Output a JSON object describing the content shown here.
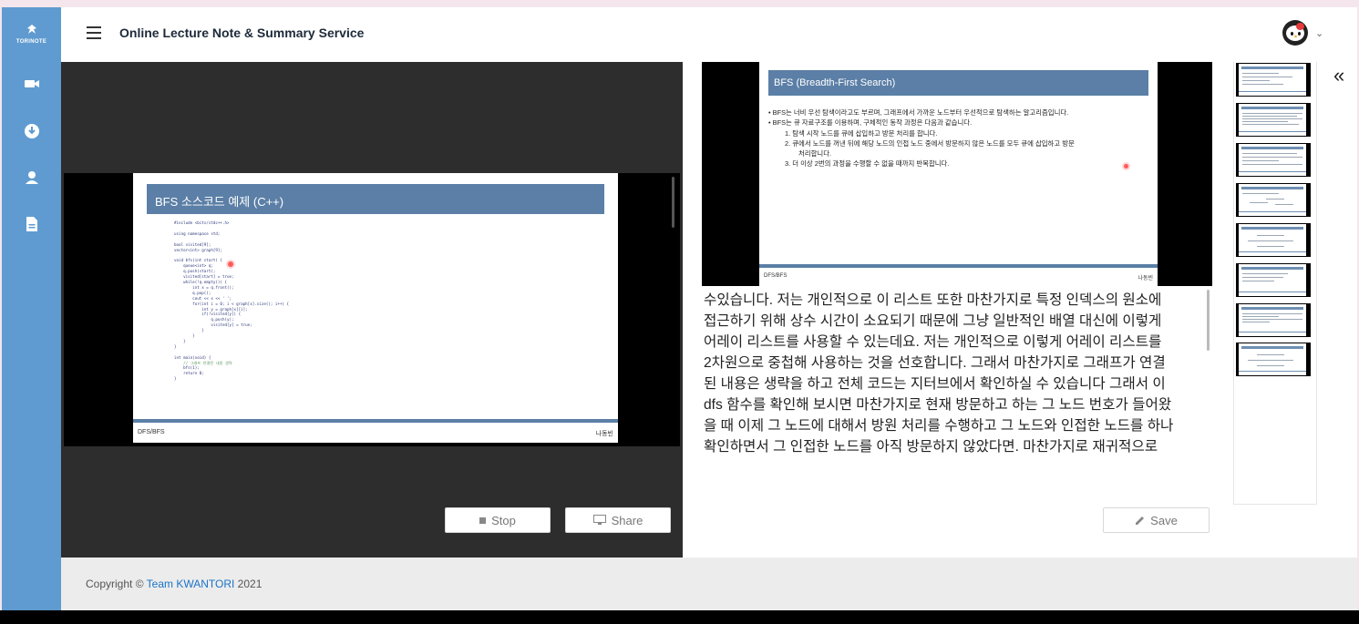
{
  "app": {
    "logo_text": "TORINOTE",
    "title": "Online Lecture Note & Summary Service"
  },
  "sidebar": {
    "items": [
      {
        "icon": "video-camera-icon"
      },
      {
        "icon": "download-icon"
      },
      {
        "icon": "user-icon"
      },
      {
        "icon": "document-icon"
      }
    ]
  },
  "video": {
    "slide": {
      "title": "BFS 소스코드 예제 (C++)",
      "footer_left": "DFS/BFS",
      "footer_right": "나동빈",
      "code_lines": [
        "#include <bits/stdc++.h>",
        "",
        "using namespace std;",
        "",
        "bool visited[9];",
        "vector<int> graph[9];",
        "",
        "void bfs(int start) {",
        "    queue<int> q;",
        "    q.push(start);",
        "    visited[start] = true;",
        "    while(!q.empty()) {",
        "        int x = q.front();",
        "        q.pop();",
        "        cout << x << ' ';",
        "        for(int i = 0; i < graph[x].size(); i++) {",
        "            int y = graph[x][i];",
        "            if(!visited[y]) {",
        "                q.push(y);",
        "                visited[y] = true;",
        "            }",
        "        }",
        "    }",
        "}",
        "",
        "int main(void) {",
        "    // 그래프 연결된 내용 생략",
        "    bfs(1);",
        "    return 0;",
        "}"
      ]
    },
    "stop_label": "Stop",
    "share_label": "Share"
  },
  "note": {
    "slide": {
      "title": "BFS (Breadth-First Search)",
      "bullets": [
        "•  BFS는 너비 우선 탐색이라고도 부르며, 그래프에서 가까운 노드부터 우선적으로 탐색하는 알고리즘입니다.",
        "•  BFS는 큐 자료구조를 이용하며, 구체적인 동작 과정은 다음과 같습니다.",
        "1.  탐색 시작 노드를 큐에 삽입하고 방문 처리를 합니다.",
        "2.  큐에서 노드를 꺼낸 뒤에 해당 노드의 인접 노드 중에서 방문하지 않은 노드를 모두 큐에 삽입하고 방문",
        "처리합니다.",
        "3.  더 이상 2번의 과정을 수행할 수 없을 때까지 반복합니다."
      ],
      "footer_left": "DFS/BFS",
      "footer_right": "나동빈"
    },
    "transcript_lines": [
      "수있습니다. 저는 개인적으로 이 리스트 또한 마찬가지로 특정 인덱스의 원소에",
      "접근하기 위해 상수 시간이 소요되기 때문에 그냥 일반적인 배열 대신에 이렇게",
      "어레이 리스트를 사용할 수 있는데요. 저는 개인적으로 이렇게 어레이 리스트를",
      "2차원으로 중첩해 사용하는 것을 선호합니다. 그래서 마찬가지로 그래프가 연결",
      "된 내용은 생략을 하고 전체 코드는 지터브에서 확인하실 수 있습니다 그래서 이",
      "dfs 함수를 확인해 보시면 마찬가지로 현재 방문하고 하는 그 노드 번호가 들어왔",
      "을 때 이제 그 노드에 대해서 방원 처리를 수행하고 그 노드와 인접한 노드를 하나",
      "확인하면서 그 인접한 노드를 아직 방문하지 않았다면. 마찬가지로 재귀적으로"
    ],
    "save_label": "Save"
  },
  "thumbnails": {
    "count": 8,
    "collapse_icon": "double-chevron-left-icon",
    "collapse_glyph": "«"
  },
  "footer": {
    "copyright_prefix": "Copyright © ",
    "team_link": "Team KWANTORI",
    "copyright_suffix": " 2021"
  },
  "colors": {
    "sidebar": "#5f9bd0",
    "slide_header": "#5b7fa6",
    "link": "#1a73c8"
  }
}
